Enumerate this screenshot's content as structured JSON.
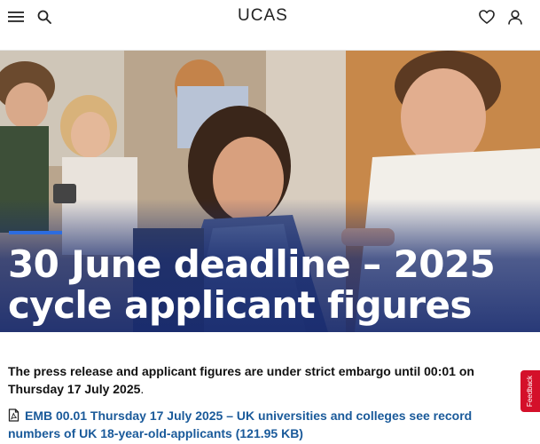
{
  "header": {
    "logo_text": "UCAS",
    "menu_icon": "hamburger-menu-icon",
    "search_icon": "search-icon",
    "favourites_icon": "heart-icon",
    "account_icon": "user-icon"
  },
  "hero": {
    "title": "30 June deadline – 2025 cycle applicant figures",
    "accent_color": "#2d6cdf"
  },
  "content": {
    "embargo_text": "The press release and applicant figures are under strict embargo until 00:01 on Thursday 17 July 2025",
    "embargo_suffix": ".",
    "document_link": "EMB 00.01 Thursday 17 July 2025 – UK universities and colleges see record numbers of UK 18-year-old-applicants (121.95 KB)",
    "document_icon": "pdf-file-icon",
    "link_color": "#1a5a9a"
  },
  "feedback": {
    "label": "Feedback",
    "color": "#d4102a"
  }
}
